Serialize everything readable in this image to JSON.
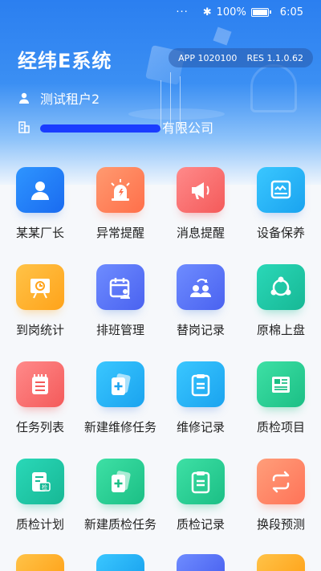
{
  "status_bar": {
    "dots": "···",
    "battery": "100%",
    "time": "6:05"
  },
  "app": {
    "title": "经纬E系统",
    "app_version": "APP 1020100",
    "res_version": "RES 1.1.0.62"
  },
  "user": {
    "tenant": "测试租户2",
    "company_suffix": "有限公司"
  },
  "tiles": [
    {
      "label": "某某厂长",
      "icon": "person-icon"
    },
    {
      "label": "异常提醒",
      "icon": "alarm-light-icon"
    },
    {
      "label": "消息提醒",
      "icon": "megaphone-icon"
    },
    {
      "label": "设备保养",
      "icon": "device-icon"
    },
    {
      "label": "到岗统计",
      "icon": "clock-board-icon"
    },
    {
      "label": "排班管理",
      "icon": "calendar-user-icon"
    },
    {
      "label": "替岗记录",
      "icon": "swap-users-icon"
    },
    {
      "label": "原棉上盘",
      "icon": "share-nodes-icon"
    },
    {
      "label": "任务列表",
      "icon": "task-list-icon"
    },
    {
      "label": "新建维修任务",
      "icon": "add-card-icon"
    },
    {
      "label": "维修记录",
      "icon": "clipboard-icon"
    },
    {
      "label": "质检项目",
      "icon": "news-icon"
    },
    {
      "label": "质检计划",
      "icon": "inspect-doc-icon"
    },
    {
      "label": "新建质检任务",
      "icon": "add-card-icon"
    },
    {
      "label": "质检记录",
      "icon": "clipboard-icon"
    },
    {
      "label": "换段预测",
      "icon": "repeat-icon"
    }
  ]
}
